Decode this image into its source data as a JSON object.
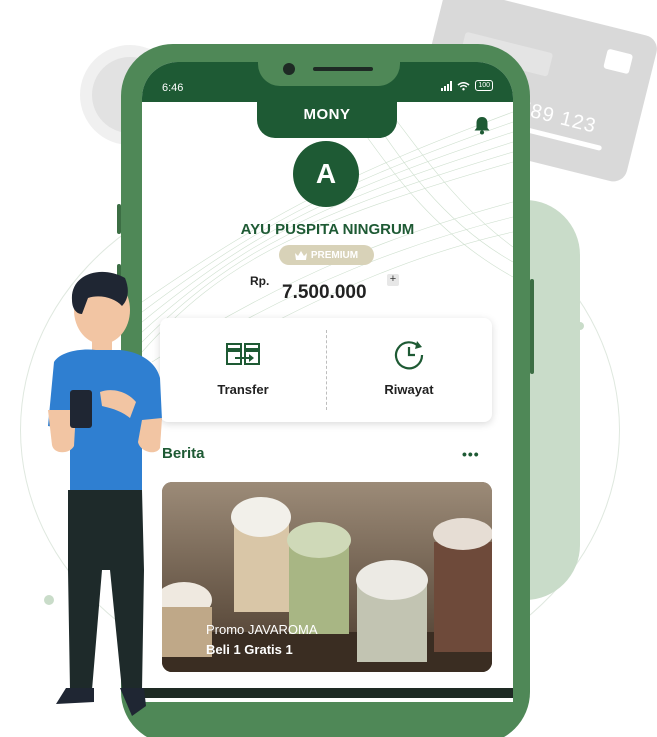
{
  "status": {
    "time": "6:46",
    "battery": "100"
  },
  "app": {
    "title": "MONY"
  },
  "profile": {
    "initial": "A",
    "name": "AYU PUSPITA NINGRUM",
    "tier": "PREMIUM"
  },
  "balance": {
    "currency": "Rp.",
    "amount": "7.500.000",
    "add_label": "+"
  },
  "actions": [
    {
      "label": "Transfer",
      "icon": "transfer-icon"
    },
    {
      "label": "Riwayat",
      "icon": "history-icon"
    }
  ],
  "news": {
    "title": "Berita",
    "more_label": "•••",
    "card": {
      "caption_line1": "Promo JAVAROMA",
      "caption_line2": "Beli 1 Gratis 1"
    }
  },
  "decor": {
    "card_number": "789 123"
  },
  "colors": {
    "primary": "#1e5a34",
    "phone_body": "#4f8857",
    "premium_badge": "#d8d2b8"
  }
}
